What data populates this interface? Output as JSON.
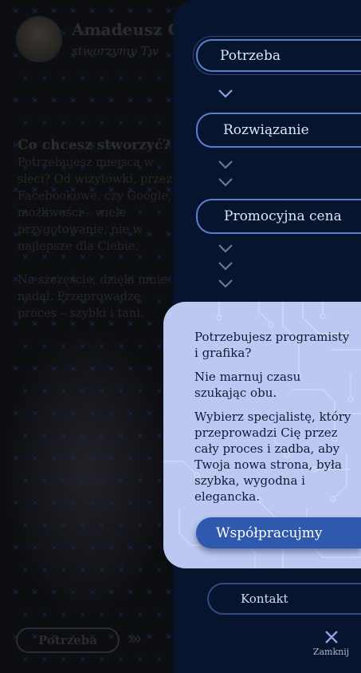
{
  "background": {
    "profile_name": "Amadeusz Cz",
    "profile_tagline": "stworzymy Tw",
    "heading": "Co chcesz stworzyć?",
    "text_lines": [
      "Potrzebujesz miejsca w",
      "sieci? Od wizytówki, przez",
      "Facebookowe, czy Google,",
      "możliwości – wiele",
      "przygotowanie, nie w",
      "najlepsze dla Ciebie.",
      "",
      "Na szczęście, dzięki mnie",
      "nadal. Przeprowadzę",
      "proces – szybki i tani."
    ],
    "footer_pill": "Potrzeba",
    "footer_arrows": "›››"
  },
  "menu": {
    "steps": [
      {
        "label": "Potrzeba",
        "active": true
      },
      {
        "label": "Rozwiązanie",
        "active": false
      },
      {
        "label": "Promocyjna cena",
        "active": false
      }
    ],
    "card": {
      "paragraphs": [
        "Potrzebujesz programisty i grafika?",
        "Nie marnuj czasu szukając obu.",
        "Wybierz specjalistę, który przeprowadzi Cię przez cały proces i zadba, aby Twoja nowa strona, była szybka, wygodna i elegancka."
      ],
      "cta_label": "Współpracujmy"
    },
    "contact_label": "Kontakt",
    "close_label": "Zamknij"
  },
  "colors": {
    "panel_bg": "#06142e",
    "accent_border": "#5c7fcf",
    "card_bg": "#bcc8f2",
    "cta_bg": "#2f59ad"
  },
  "icons": {
    "chevron": "chevron-down-icon",
    "close": "close-icon",
    "pattern": "x-pattern-icon"
  }
}
